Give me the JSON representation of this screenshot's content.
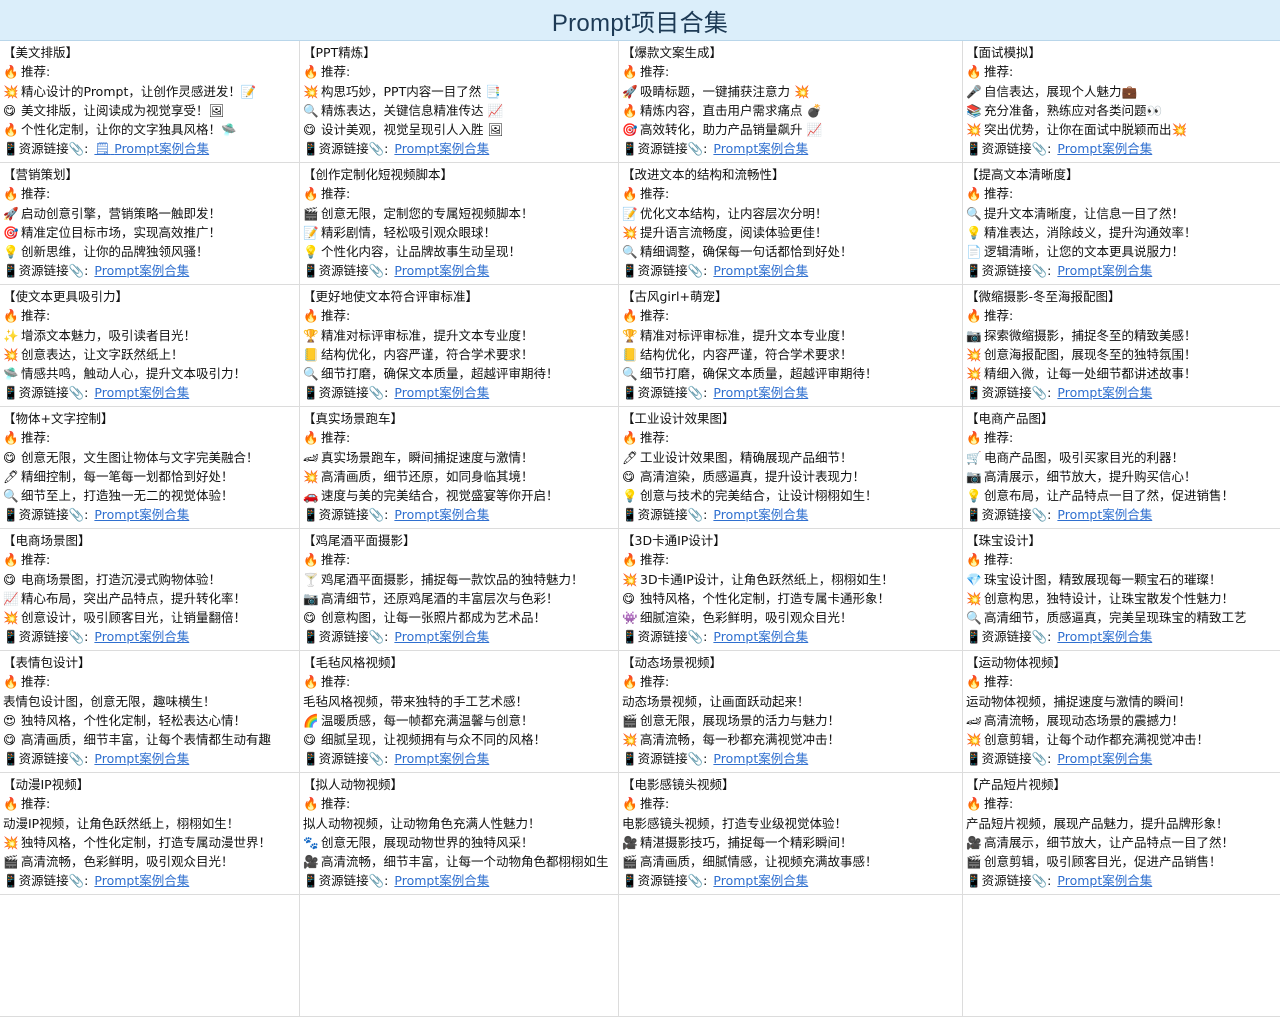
{
  "page": {
    "title": "Prompt项目合集"
  },
  "labels": {
    "recommend": "推荐:",
    "resource": "资源链接",
    "separator": ":",
    "link_text": "Prompt案例合集",
    "doc_icon": "🗒"
  },
  "icons": {
    "fire": "🔥",
    "phone": "📱",
    "clip": "📎"
  },
  "cards": [
    {
      "title": "【美文排版】",
      "lines": [
        {
          "icon": "💥",
          "text": "精心设计的Prompt，让创作灵感迸发！📝"
        },
        {
          "icon": "😋",
          "text": "美文排版，让阅读成为视觉享受！🖼"
        },
        {
          "icon": "🔥",
          "text": "个性化定制，让你的文字独具风格！🛸"
        }
      ],
      "doc_link": true
    },
    {
      "title": "【PPT精炼】",
      "lines": [
        {
          "icon": "💥",
          "text": "构思巧妙，PPT内容一目了然 📑"
        },
        {
          "icon": "🔍",
          "text": "精炼表达，关键信息精准传达 📈"
        },
        {
          "icon": "😋",
          "text": "设计美观，视觉呈现引人入胜 🖼"
        }
      ]
    },
    {
      "title": "【爆款文案生成】",
      "lines": [
        {
          "icon": "🚀",
          "text": "吸睛标题，一键捕获注意力 💥"
        },
        {
          "icon": "🔥",
          "text": "精炼内容，直击用户需求痛点 💣"
        },
        {
          "icon": "🎯",
          "text": "高效转化，助力产品销量飙升 📈"
        }
      ]
    },
    {
      "title": "【面试模拟】",
      "lines": [
        {
          "icon": "🎤",
          "text": "自信表达，展现个人魅力💼"
        },
        {
          "icon": "📚",
          "text": "充分准备，熟练应对各类问题👀"
        },
        {
          "icon": "💥",
          "text": "突出优势，让你在面试中脱颖而出💥"
        }
      ]
    },
    {
      "title": "【营销策划】",
      "lines": [
        {
          "icon": "🚀",
          "text": "启动创意引擎，营销策略一触即发！"
        },
        {
          "icon": "🎯",
          "text": "精准定位目标市场，实现高效推广！"
        },
        {
          "icon": "💡",
          "text": "创新思维，让你的品牌独领风骚！"
        }
      ]
    },
    {
      "title": "【创作定制化短视频脚本】",
      "lines": [
        {
          "icon": "🎬",
          "text": "创意无限，定制您的专属短视频脚本！"
        },
        {
          "icon": "📝",
          "text": "精彩剧情，轻松吸引观众眼球！"
        },
        {
          "icon": "💡",
          "text": "个性化内容，让品牌故事生动呈现！"
        }
      ]
    },
    {
      "title": "【改进文本的结构和流畅性】",
      "lines": [
        {
          "icon": "📝",
          "text": "优化文本结构，让内容层次分明！"
        },
        {
          "icon": "💥",
          "text": "提升语言流畅度，阅读体验更佳！"
        },
        {
          "icon": "🔍",
          "text": "精细调整，确保每一句话都恰到好处！"
        }
      ]
    },
    {
      "title": "【提高文本清晰度】",
      "lines": [
        {
          "icon": "🔍",
          "text": "提升文本清晰度，让信息一目了然！"
        },
        {
          "icon": "💡",
          "text": "精准表达，消除歧义，提升沟通效率！"
        },
        {
          "icon": "📄",
          "text": "逻辑清晰，让您的文本更具说服力！"
        }
      ]
    },
    {
      "title": "【使文本更具吸引力】",
      "lines": [
        {
          "icon": "✨",
          "text": "增添文本魅力，吸引读者目光！"
        },
        {
          "icon": "💥",
          "text": "创意表达，让文字跃然纸上！"
        },
        {
          "icon": "🛸",
          "text": "情感共鸣，触动人心，提升文本吸引力！"
        }
      ]
    },
    {
      "title": "【更好地使文本符合评审标准】",
      "lines": [
        {
          "icon": "🏆",
          "text": "精准对标评审标准，提升文本专业度！"
        },
        {
          "icon": "📒",
          "text": "结构优化，内容严谨，符合学术要求！"
        },
        {
          "icon": "🔍",
          "text": "细节打磨，确保文本质量，超越评审期待！"
        }
      ]
    },
    {
      "title": "【古风girl+萌宠】",
      "lines": [
        {
          "icon": "🏆",
          "text": "精准对标评审标准，提升文本专业度！"
        },
        {
          "icon": "📒",
          "text": "结构优化，内容严谨，符合学术要求！"
        },
        {
          "icon": "🔍",
          "text": "细节打磨，确保文本质量，超越评审期待！"
        }
      ]
    },
    {
      "title": "【微缩摄影-冬至海报配图】",
      "lines": [
        {
          "icon": "📷",
          "text": "探索微缩摄影，捕捉冬至的精致美感！"
        },
        {
          "icon": "💥",
          "text": "创意海报配图，展现冬至的独特氛围！"
        },
        {
          "icon": "💥",
          "text": "精细入微，让每一处细节都讲述故事！"
        }
      ]
    },
    {
      "title": "【物体+文字控制】",
      "lines": [
        {
          "icon": "😋",
          "text": "创意无限，文生图让物体与文字完美融合！"
        },
        {
          "icon": "🖊",
          "text": "精细控制，每一笔每一划都恰到好处！"
        },
        {
          "icon": "🔍",
          "text": "细节至上，打造独一无二的视觉体验！"
        }
      ]
    },
    {
      "title": "【真实场景跑车】",
      "lines": [
        {
          "icon": "🏎",
          "text": "真实场景跑车，瞬间捕捉速度与激情！"
        },
        {
          "icon": "💥",
          "text": "高清画质，细节还原，如同身临其境！"
        },
        {
          "icon": "🚗",
          "text": "速度与美的完美结合，视觉盛宴等你开启！"
        }
      ]
    },
    {
      "title": "【工业设计效果图】",
      "lines": [
        {
          "icon": "🖊",
          "text": "工业设计效果图，精确展现产品细节！"
        },
        {
          "icon": "😋",
          "text": "高清渲染，质感逼真，提升设计表现力！"
        },
        {
          "icon": "💡",
          "text": "创意与技术的完美结合，让设计栩栩如生！"
        }
      ]
    },
    {
      "title": "【电商产品图】",
      "lines": [
        {
          "icon": "🛒",
          "text": "电商产品图，吸引买家目光的利器！"
        },
        {
          "icon": "📷",
          "text": "高清展示，细节放大，提升购买信心！"
        },
        {
          "icon": "💡",
          "text": "创意布局，让产品特点一目了然，促进销售！"
        }
      ]
    },
    {
      "title": "【电商场景图】",
      "lines": [
        {
          "icon": "😋",
          "text": "电商场景图，打造沉浸式购物体验！"
        },
        {
          "icon": "📈",
          "text": "精心布局，突出产品特点，提升转化率！"
        },
        {
          "icon": "💥",
          "text": "创意设计，吸引顾客目光，让销量翻倍！"
        }
      ]
    },
    {
      "title": "【鸡尾酒平面摄影】",
      "lines": [
        {
          "icon": "🍸",
          "text": "鸡尾酒平面摄影，捕捉每一款饮品的独特魅力！"
        },
        {
          "icon": "📷",
          "text": "高清细节，还原鸡尾酒的丰富层次与色彩！"
        },
        {
          "icon": "😋",
          "text": "创意构图，让每一张照片都成为艺术品！"
        }
      ]
    },
    {
      "title": "【3D卡通IP设计】",
      "lines": [
        {
          "icon": "💥",
          "text": "3D卡通IP设计，让角色跃然纸上，栩栩如生！"
        },
        {
          "icon": "😋",
          "text": "独特风格，个性化定制，打造专属卡通形象！"
        },
        {
          "icon": "👾",
          "text": "细腻渲染，色彩鲜明，吸引观众目光！"
        }
      ]
    },
    {
      "title": "【珠宝设计】",
      "lines": [
        {
          "icon": "💎",
          "text": "珠宝设计图，精致展现每一颗宝石的璀璨！"
        },
        {
          "icon": "💥",
          "text": "创意构思，独特设计，让珠宝散发个性魅力！"
        },
        {
          "icon": "🔍",
          "text": "高清细节，质感逼真，完美呈现珠宝的精致工艺"
        }
      ]
    },
    {
      "title": "【表情包设计】",
      "lines": [
        {
          "icon": "",
          "text": "表情包设计图，创意无限，趣味横生！"
        },
        {
          "icon": "😍",
          "text": "独特风格，个性化定制，轻松表达心情！"
        },
        {
          "icon": "😋",
          "text": "高清画质，细节丰富，让每个表情都生动有趣"
        }
      ]
    },
    {
      "title": "【毛毡风格视频】",
      "lines": [
        {
          "icon": "",
          "text": "毛毡风格视频，带来独特的手工艺术感！"
        },
        {
          "icon": "🌈",
          "text": "温暖质感，每一帧都充满温馨与创意！"
        },
        {
          "icon": "😋",
          "text": "细腻呈现，让视频拥有与众不同的风格！"
        }
      ]
    },
    {
      "title": "【动态场景视频】",
      "lines": [
        {
          "icon": "",
          "text": "动态场景视频，让画面跃动起来！"
        },
        {
          "icon": "🎬",
          "text": "创意无限，展现场景的活力与魅力！"
        },
        {
          "icon": "💥",
          "text": "高清流畅，每一秒都充满视觉冲击！"
        }
      ]
    },
    {
      "title": "【运动物体视频】",
      "lines": [
        {
          "icon": "",
          "text": "运动物体视频，捕捉速度与激情的瞬间！"
        },
        {
          "icon": "🏎",
          "text": "高清流畅，展现动态场景的震撼力！"
        },
        {
          "icon": "💥",
          "text": "创意剪辑，让每个动作都充满视觉冲击！"
        }
      ]
    },
    {
      "title": "【动漫IP视频】",
      "lines": [
        {
          "icon": "",
          "text": "动漫IP视频，让角色跃然纸上，栩栩如生！"
        },
        {
          "icon": "💥",
          "text": "独特风格，个性化定制，打造专属动漫世界！"
        },
        {
          "icon": "🎬",
          "text": "高清流畅，色彩鲜明，吸引观众目光！"
        }
      ]
    },
    {
      "title": "【拟人动物视频】",
      "lines": [
        {
          "icon": "",
          "text": "拟人动物视频，让动物角色充满人性魅力！"
        },
        {
          "icon": "🐾",
          "text": "创意无限，展现动物世界的独特风采！"
        },
        {
          "icon": "🎥",
          "text": "高清流畅，细节丰富，让每一个动物角色都栩栩如生"
        }
      ]
    },
    {
      "title": "【电影感镜头视频】",
      "lines": [
        {
          "icon": "",
          "text": "电影感镜头视频，打造专业级视觉体验！"
        },
        {
          "icon": "🎥",
          "text": "精湛摄影技巧，捕捉每一个精彩瞬间！"
        },
        {
          "icon": "🎬",
          "text": "高清画质，细腻情感，让视频充满故事感！"
        }
      ]
    },
    {
      "title": "【产品短片视频】",
      "lines": [
        {
          "icon": "",
          "text": "产品短片视频，展现产品魅力，提升品牌形象！"
        },
        {
          "icon": "🎥",
          "text": "高清展示，细节放大，让产品特点一目了然！"
        },
        {
          "icon": "🎬",
          "text": "创意剪辑，吸引顾客目光，促进产品销售！"
        }
      ]
    }
  ]
}
